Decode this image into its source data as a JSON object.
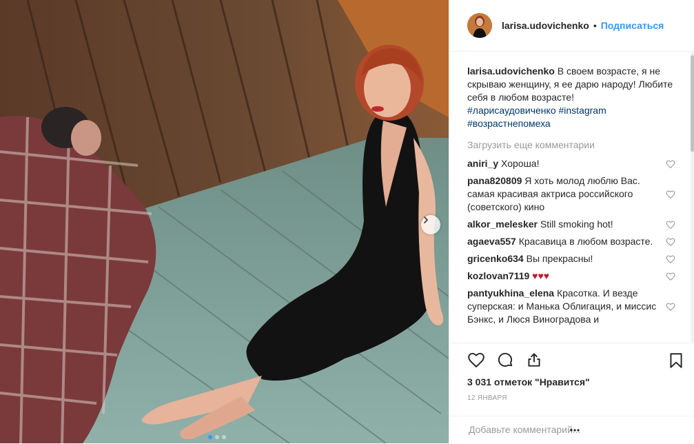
{
  "post": {
    "username": "larisa.udovichenko",
    "separator": "•",
    "follow_label": "Подписаться",
    "caption": {
      "username": "larisa.udovichenko",
      "text": "В своем возрасте, я не скрываю женщину, я ее дарю народу! Любите себя в любом возрасте!",
      "hashtags": [
        "#ларисаудовиченко",
        "#instagram",
        "#возрастнепомеха"
      ]
    },
    "load_more_label": "Загрузить еще комментарии",
    "comments": [
      {
        "user": "aniri_y",
        "text": "Хороша!"
      },
      {
        "user": "pana820809",
        "text": "Я хоть молод люблю Вас. самая красивая актриса российского (советского) кино"
      },
      {
        "user": "alkor_melesker",
        "text": "Still smoking hot!"
      },
      {
        "user": "agaeva557",
        "text": "Красавица в любом возрасте."
      },
      {
        "user": "gricenko634",
        "text": "Вы прекрасны!"
      },
      {
        "user": "kozlovan7119",
        "text": "♥♥♥"
      },
      {
        "user": "pantyukhina_elena",
        "text": "Красотка. И везде суперская: и Манька Облигация, и миссис Бэнкс, и Люся Виноградова и"
      }
    ],
    "likes_label": "3 031 отметок \"Нравится\"",
    "date_label": "12 ЯНВАРЯ",
    "add_comment_placeholder": "Добавьте комментарий...",
    "carousel": {
      "slides": 3,
      "active": 0
    }
  },
  "colors": {
    "link": "#3897f0",
    "hashtag": "#003569",
    "heart": "#c0182f",
    "muted": "#999999"
  },
  "icons": [
    "next-arrow-icon",
    "like-icon",
    "comment-icon",
    "share-icon",
    "bookmark-icon",
    "heart-small-icon",
    "more-icon"
  ]
}
